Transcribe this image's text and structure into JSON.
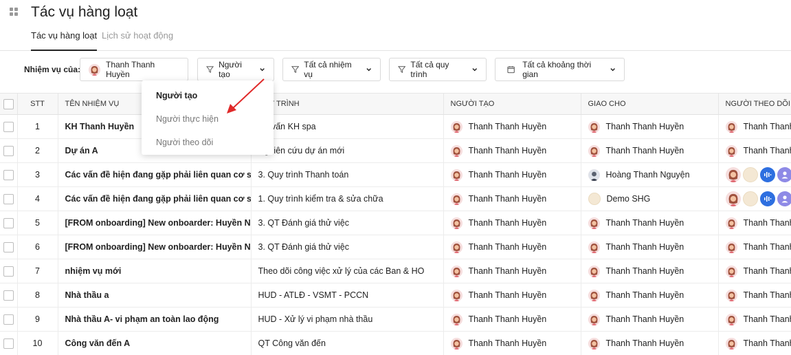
{
  "header": {
    "title": "Tác vụ hàng loạt",
    "tabs": [
      {
        "label": "Tác vụ hàng loạt",
        "active": true
      },
      {
        "label": "Lịch sử hoạt động",
        "active": false
      }
    ]
  },
  "filters": {
    "label": "Nhiệm vụ của:",
    "user": "Thanh Thanh Huyền",
    "role_filter": "Người tạo",
    "task_filter": "Tất cả nhiệm vụ",
    "process_filter": "Tất cả quy trình",
    "time_filter": "Tất cả khoảng thời gian"
  },
  "dropdown": {
    "items": [
      "Người tạo",
      "Người thực hiện",
      "Người theo dõi"
    ],
    "selected": "Người tạo"
  },
  "table": {
    "columns": [
      "STT",
      "TÊN NHIỆM VỤ",
      "QUY TRÌNH",
      "NGƯỜI TẠO",
      "GIAO CHO",
      "NGƯỜI THEO DÕI"
    ],
    "rows": [
      {
        "stt": "1",
        "name": "KH Thanh Huyền",
        "process": "Tư vấn KH spa",
        "creator": "Thanh Thanh Huyền",
        "assignee": "Thanh Thanh Huyền",
        "follower": "Thanh Thanh Huyền"
      },
      {
        "stt": "2",
        "name": "Dự án A",
        "process": "Nghiên cứu dự án mới",
        "creator": "Thanh Thanh Huyền",
        "assignee": "Thanh Thanh Huyền",
        "follower": "Thanh Thanh Huyền"
      },
      {
        "stt": "3",
        "name": "Các vấn đề hiện đang gặp phải liên quan cơ sở",
        "process": "3. Quy trình Thanh toán",
        "creator": "Thanh Thanh Huyền",
        "assignee": "Hoàng Thanh Nguyện",
        "follower": ""
      },
      {
        "stt": "4",
        "name": "Các vấn đề hiện đang gặp phải liên quan cơ sở",
        "process": "1. Quy trình kiểm tra & sửa chữa",
        "creator": "Thanh Thanh Huyền",
        "assignee": "Demo SHG",
        "follower": ""
      },
      {
        "stt": "5",
        "name": "[FROM onboarding] New onboarder: Huyền Ngọc",
        "process": "3. QT Đánh giá thử việc",
        "creator": "Thanh Thanh Huyền",
        "assignee": "Thanh Thanh Huyền",
        "follower": "Thanh Thanh Huyền"
      },
      {
        "stt": "6",
        "name": "[FROM onboarding] New onboarder: Huyền Ngọc",
        "process": "3. QT Đánh giá thử việc",
        "creator": "Thanh Thanh Huyền",
        "assignee": "Thanh Thanh Huyền",
        "follower": "Thanh Thanh Huyền"
      },
      {
        "stt": "7",
        "name": "nhiệm vụ mới",
        "process": "Theo dõi công việc xử lý của các Ban & HO",
        "creator": "Thanh Thanh Huyền",
        "assignee": "Thanh Thanh Huyền",
        "follower": "Thanh Thanh Huyền"
      },
      {
        "stt": "8",
        "name": "Nhà thầu a",
        "process": "HUD - ATLĐ - VSMT - PCCN",
        "creator": "Thanh Thanh Huyền",
        "assignee": "Thanh Thanh Huyền",
        "follower": "Thanh Thanh Huyền"
      },
      {
        "stt": "9",
        "name": "Nhà thầu A- vi phạm an toàn lao động",
        "process": "HUD - Xử lý vi phạm nhà thầu",
        "creator": "Thanh Thanh Huyền",
        "assignee": "Thanh Thanh Huyền",
        "follower": "Thanh Thanh Huyền"
      },
      {
        "stt": "10",
        "name": "Công văn đến A",
        "process": "QT Công văn đến",
        "creator": "Thanh Thanh Huyền",
        "assignee": "Thanh Thanh Huyền",
        "follower": "Thanh Thanh Huyền"
      }
    ]
  },
  "colors": {
    "annotation_arrow": "#e02a2a",
    "assign_blue": "#2e6fe0",
    "assign_purple": "#8e8ae6"
  }
}
